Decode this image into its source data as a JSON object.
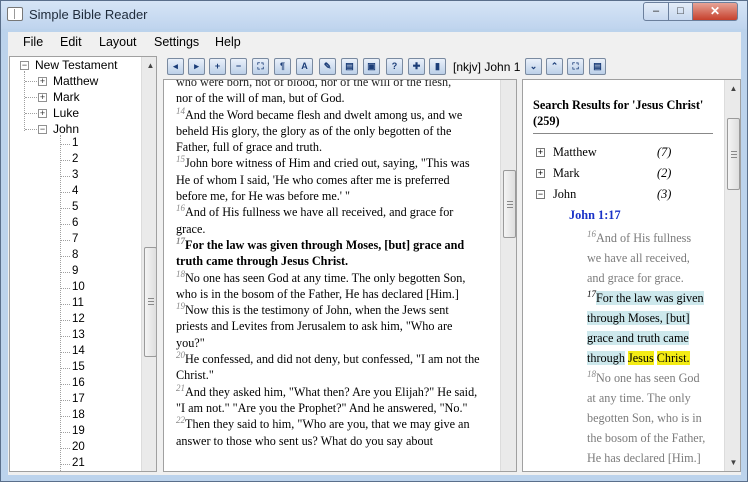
{
  "window": {
    "title": "Simple Bible Reader",
    "minimize": "–",
    "maximize": "□",
    "close": "✕"
  },
  "menu": [
    "File",
    "Edit",
    "Layout",
    "Settings",
    "Help"
  ],
  "tree": {
    "root": "New Testament",
    "books": [
      "Matthew",
      "Mark",
      "Luke",
      "John"
    ],
    "chapters": [
      "1",
      "2",
      "3",
      "4",
      "5",
      "6",
      "7",
      "8",
      "9",
      "10",
      "11",
      "12",
      "13",
      "14",
      "15",
      "16",
      "17",
      "18",
      "19",
      "20",
      "21"
    ]
  },
  "toolbar": {
    "icons": [
      "back-icon",
      "forward-icon",
      "zoom-in-icon",
      "zoom-out-icon",
      "fit-icon",
      "paragraph-icon",
      "font-icon",
      "edit-icon",
      "split-icon",
      "save-icon",
      "help-icon",
      "flag-icon",
      "books-icon",
      "down-icon",
      "up-icon",
      "fullscreen-icon",
      "notes-icon"
    ],
    "reference": "[nkjv] John 1"
  },
  "reader": {
    "top_fragment": "who were born, not of blood, nor of the will of the flesh,",
    "top_line2": "nor of the will of man, but of God.",
    "verses": [
      {
        "n": "14",
        "text": "And the Word became flesh and dwelt among us, and we beheld His glory, the glory as of the only begotten of the Father, full of grace and truth."
      },
      {
        "n": "15",
        "text": "John bore witness of Him and cried out, saying, \"This was He of whom I said, 'He who comes after me is preferred before me, for He was before me.' \""
      },
      {
        "n": "16",
        "text": "And of His fullness we have all received, and grace for grace."
      },
      {
        "n": "17",
        "text": "For the law was given through Moses, [but] grace and truth came through Jesus Christ."
      },
      {
        "n": "18",
        "text": "No one has seen God at any time. The only begotten Son, who is in the bosom of the Father, He has declared [Him.]"
      },
      {
        "n": "19",
        "text": "Now this is the testimony of John, when the Jews sent priests and Levites from Jerusalem to ask him, \"Who are you?\""
      },
      {
        "n": "20",
        "text": "He confessed, and did not deny, but confessed, \"I am not the Christ.\""
      },
      {
        "n": "21",
        "text": "And they asked him, \"What then? Are you Elijah?\" He said, \"I am not.\" \"Are you the Prophet?\" And he answered, \"No.\""
      },
      {
        "n": "22",
        "text": "Then they said to him, \"Who are you, that we may give an answer to those who sent us? What do you say about"
      }
    ]
  },
  "results": {
    "title": "Search Results for 'Jesus Christ' (259)",
    "books": [
      {
        "name": "Matthew",
        "count": "(7)",
        "expander": "+"
      },
      {
        "name": "Mark",
        "count": "(2)",
        "expander": "+"
      },
      {
        "name": "John",
        "count": "(3)",
        "expander": "−"
      }
    ],
    "ref": "John 1:17",
    "v16_num": "16",
    "v16_text": "And of His fullness we have all received, and grace for grace.",
    "v17_num": "17",
    "v17_pre": "For the law was given through Moses, [but] grace and truth came through",
    "v17_hl1": "Jesus",
    "v17_hl2": "Christ.",
    "v18_num": "18",
    "v18_text": "No one has seen God at any time. The only begotten Son, who is in the bosom of the Father, He has declared [Him.]"
  },
  "colors": {
    "ref_blue": "#1a32c8",
    "highlight_teal": "#cde8ec",
    "highlight_yellow": "#f3ec15"
  }
}
